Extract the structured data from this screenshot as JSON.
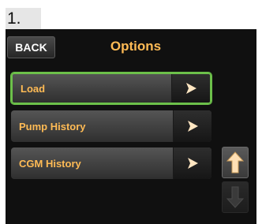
{
  "step": {
    "label": "1."
  },
  "header": {
    "back_label": "BACK",
    "title": "Options"
  },
  "menu": {
    "items": [
      {
        "label": "Load",
        "selected": true
      },
      {
        "label": "Pump History",
        "selected": false
      },
      {
        "label": "CGM History",
        "selected": false
      }
    ]
  },
  "scroll": {
    "up_enabled": true,
    "down_enabled": false
  },
  "colors": {
    "accent_label": "#ffbb55",
    "selection": "#6cc04a",
    "screen_bg": "#101010"
  },
  "icons": {
    "item_arrow": "chevron-right-icon",
    "scroll_up": "arrow-up-icon",
    "scroll_down": "arrow-down-icon"
  }
}
